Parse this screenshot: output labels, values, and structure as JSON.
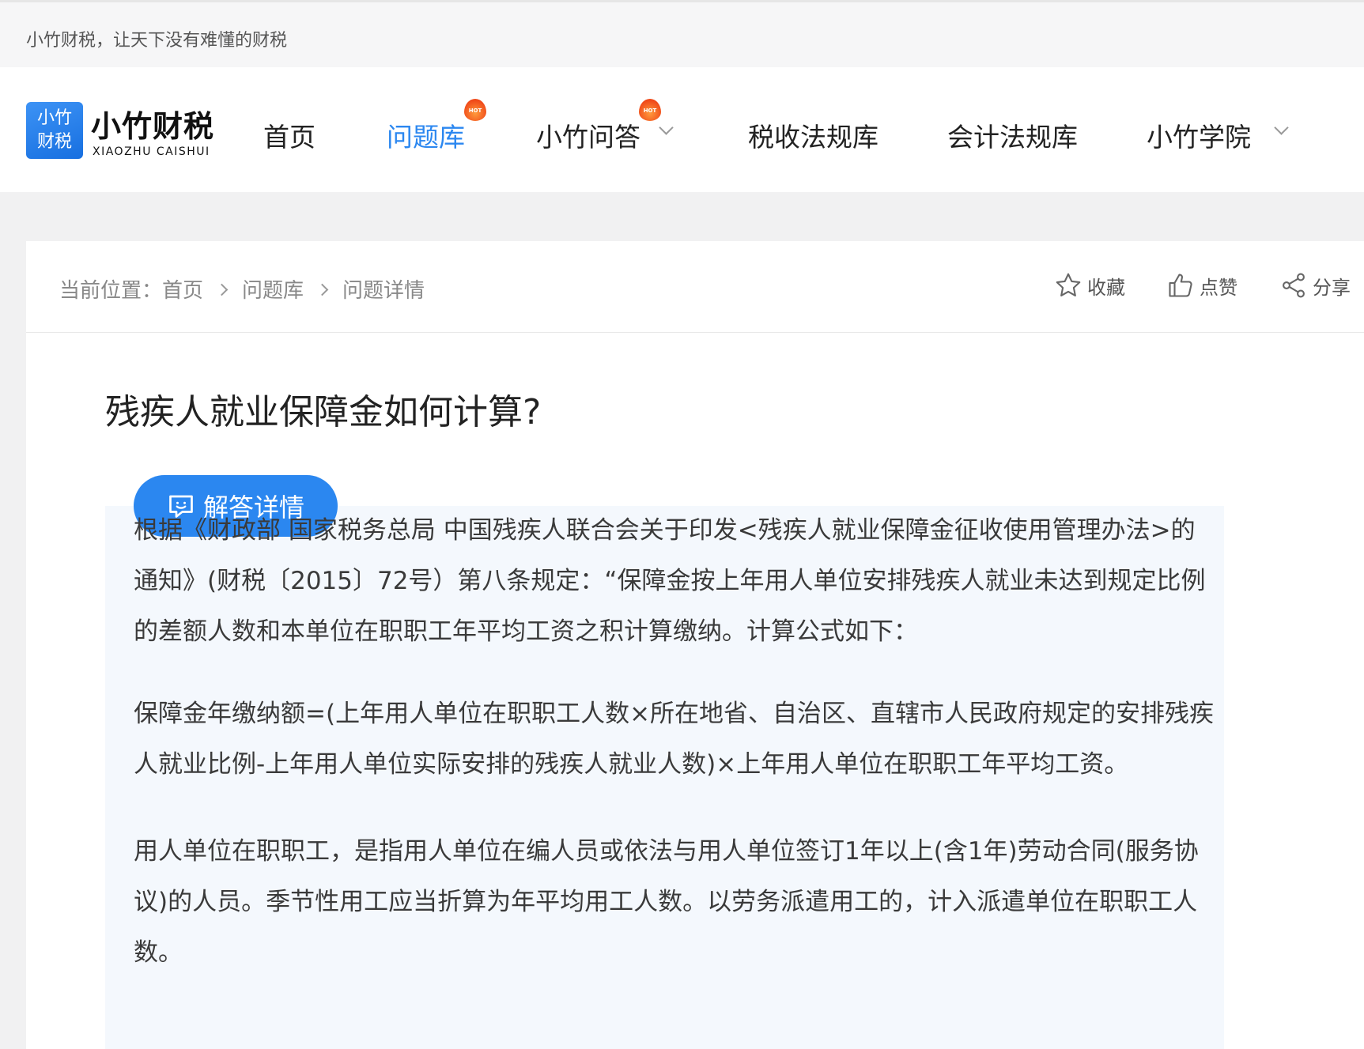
{
  "topbar": {
    "slogan": "小竹财税，让天下没有难懂的财税"
  },
  "logo": {
    "mark_line1": "小竹",
    "mark_line2": "财税",
    "name": "小竹财税",
    "sub": "XIAOZHU CAISHUI"
  },
  "nav": {
    "items": [
      {
        "label": "首页"
      },
      {
        "label": "问题库",
        "badge": "HOT"
      },
      {
        "label": "小竹问答",
        "badge": "HOT"
      },
      {
        "label": "税收法规库"
      },
      {
        "label": "会计法规库"
      },
      {
        "label": "小竹学院"
      }
    ]
  },
  "breadcrumb": {
    "prefix": "当前位置：",
    "items": [
      "首页",
      "问题库",
      "问题详情"
    ]
  },
  "actions": {
    "favorite": "收藏",
    "like": "点赞",
    "share": "分享"
  },
  "question": {
    "title": "残疾人就业保障金如何计算?"
  },
  "answer": {
    "button_label": "解答详情",
    "paragraphs": [
      "根据《财政部 国家税务总局 中国残疾人联合会关于印发<残疾人就业保障金征收使用管理办法>的通知》(财税〔2015〕72号）第八条规定：“保障金按上年用人单位安排残疾人就业未达到规定比例的差额人数和本单位在职职工年平均工资之积计算缴纳。计算公式如下：",
      "保障金年缴纳额=(上年用人单位在职职工人数×所在地省、自治区、直辖市人民政府规定的安排残疾人就业比例-上年用人单位实际安排的残疾人就业人数)×上年用人单位在职职工年平均工资。",
      "用人单位在职职工，是指用人单位在编人员或依法与用人单位签订1年以上(含1年)劳动合同(服务协议)的人员。季节性用工应当折算为年平均用工人数。以劳务派遣用工的，计入派遣单位在职职工人数。"
    ]
  },
  "colors": {
    "accent": "#2b87f0",
    "answer_bg": "#f4f8fd",
    "page_bg": "#f1f1f2"
  }
}
